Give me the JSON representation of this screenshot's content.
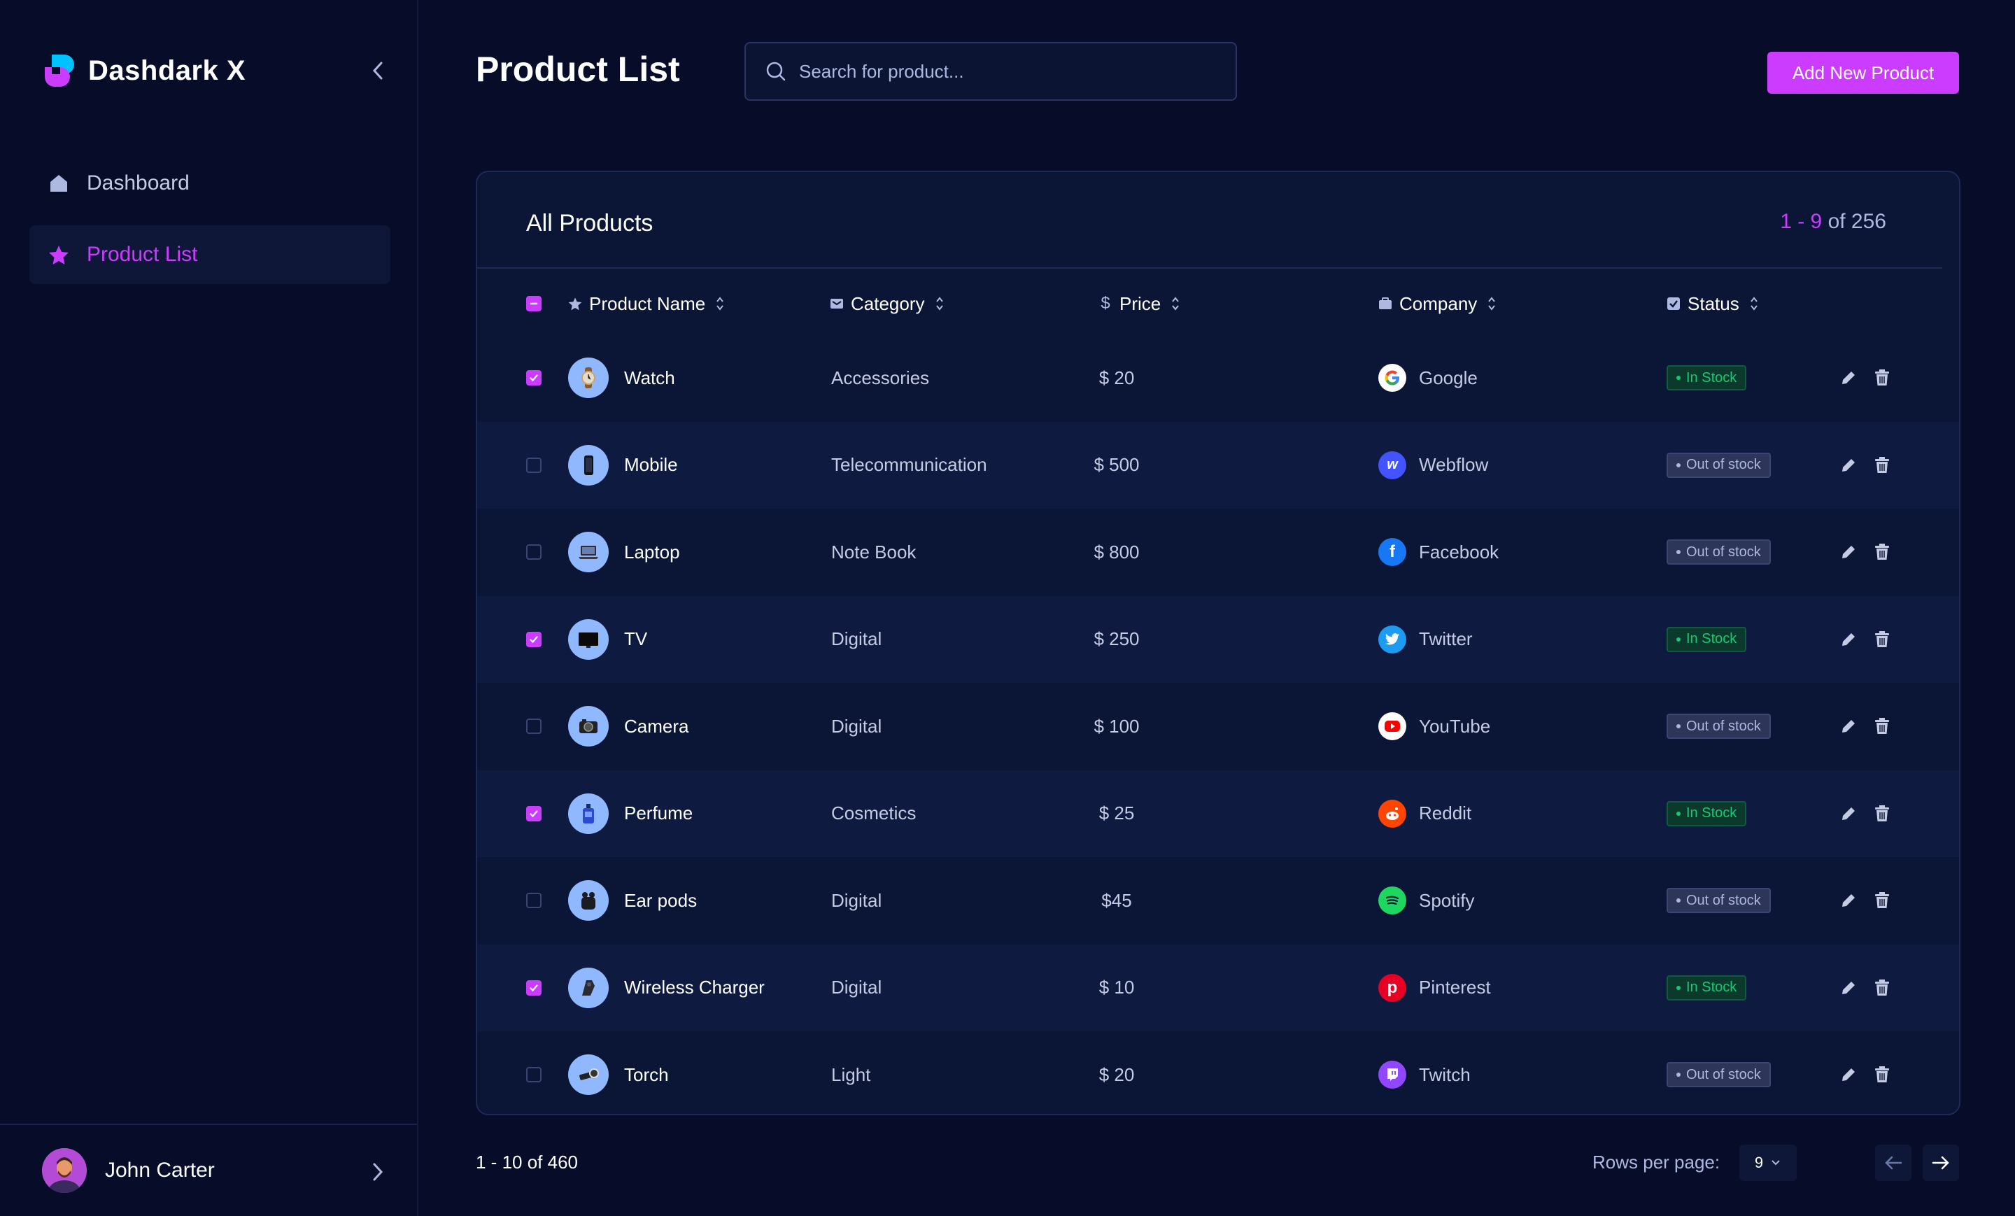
{
  "app": {
    "name": "Dashdark X",
    "accent": "#cb3cff",
    "logo_colors": [
      "#cb3cff",
      "#00c2ff"
    ]
  },
  "sidebar": {
    "items": [
      {
        "label": "Dashboard",
        "icon": "home-icon",
        "active": false
      },
      {
        "label": "Product List",
        "icon": "star-icon",
        "active": true
      }
    ],
    "user": {
      "name": "John Carter"
    }
  },
  "header": {
    "title": "Product List",
    "search_placeholder": "Search for product...",
    "add_button": "Add New Product"
  },
  "table": {
    "title": "All Products",
    "count_range": "1 - 9",
    "count_total": "of 256",
    "columns": [
      {
        "label": "Product Name",
        "icon": "star-icon"
      },
      {
        "label": "Category",
        "icon": "tag-icon"
      },
      {
        "label": "Price",
        "icon": "dollar-icon"
      },
      {
        "label": "Company",
        "icon": "briefcase-icon"
      },
      {
        "label": "Status",
        "icon": "check-square-icon"
      }
    ],
    "rows": [
      {
        "checked": true,
        "name": "Watch",
        "image": "watch-icon",
        "category": "Accessories",
        "price": "$ 20",
        "company": "Google",
        "company_logo": "google-icon",
        "status": "In Stock",
        "in_stock": true
      },
      {
        "checked": false,
        "name": "Mobile",
        "image": "mobile-icon",
        "category": "Telecommunication",
        "price": "$ 500",
        "company": "Webflow",
        "company_logo": "webflow-icon",
        "status": "Out of stock",
        "in_stock": false
      },
      {
        "checked": false,
        "name": "Laptop",
        "image": "laptop-icon",
        "category": "Note Book",
        "price": "$ 800",
        "company": "Facebook",
        "company_logo": "facebook-icon",
        "status": "Out of stock",
        "in_stock": false
      },
      {
        "checked": true,
        "name": "TV",
        "image": "tv-icon",
        "category": "Digital",
        "price": "$ 250",
        "company": "Twitter",
        "company_logo": "twitter-icon",
        "status": "In Stock",
        "in_stock": true
      },
      {
        "checked": false,
        "name": "Camera",
        "image": "camera-icon",
        "category": "Digital",
        "price": "$ 100",
        "company": "YouTube",
        "company_logo": "youtube-icon",
        "status": "Out of stock",
        "in_stock": false
      },
      {
        "checked": true,
        "name": "Perfume",
        "image": "perfume-icon",
        "category": "Cosmetics",
        "price": "$ 25",
        "company": "Reddit",
        "company_logo": "reddit-icon",
        "status": "In Stock",
        "in_stock": true
      },
      {
        "checked": false,
        "name": "Ear pods",
        "image": "earpods-icon",
        "category": "Digital",
        "price": "$45",
        "company": "Spotify",
        "company_logo": "spotify-icon",
        "status": "Out of stock",
        "in_stock": false
      },
      {
        "checked": true,
        "name": "Wireless Charger",
        "image": "charger-icon",
        "category": "Digital",
        "price": "$ 10",
        "company": "Pinterest",
        "company_logo": "pinterest-icon",
        "status": "In Stock",
        "in_stock": true
      },
      {
        "checked": false,
        "name": "Torch",
        "image": "torch-icon",
        "category": "Light",
        "price": "$ 20",
        "company": "Twitch",
        "company_logo": "twitch-icon",
        "status": "Out of stock",
        "in_stock": false
      }
    ]
  },
  "footer": {
    "range": "1 - 10 of 460",
    "rows_per_page_label": "Rows per page:",
    "rows_per_page_value": "9"
  },
  "colors": {
    "background": "#070d28",
    "card": "#0b1536",
    "in_stock": "#14ca74",
    "out_of_stock": "#aeb9e1",
    "company": {
      "Google": "#ffffff",
      "Webflow": "#4353ff",
      "Facebook": "#1877f2",
      "Twitter": "#1d9bf0",
      "YouTube": "#ffffff",
      "Reddit": "#ff4500",
      "Spotify": "#1ed760",
      "Pinterest": "#e60023",
      "Twitch": "#9146ff"
    }
  }
}
